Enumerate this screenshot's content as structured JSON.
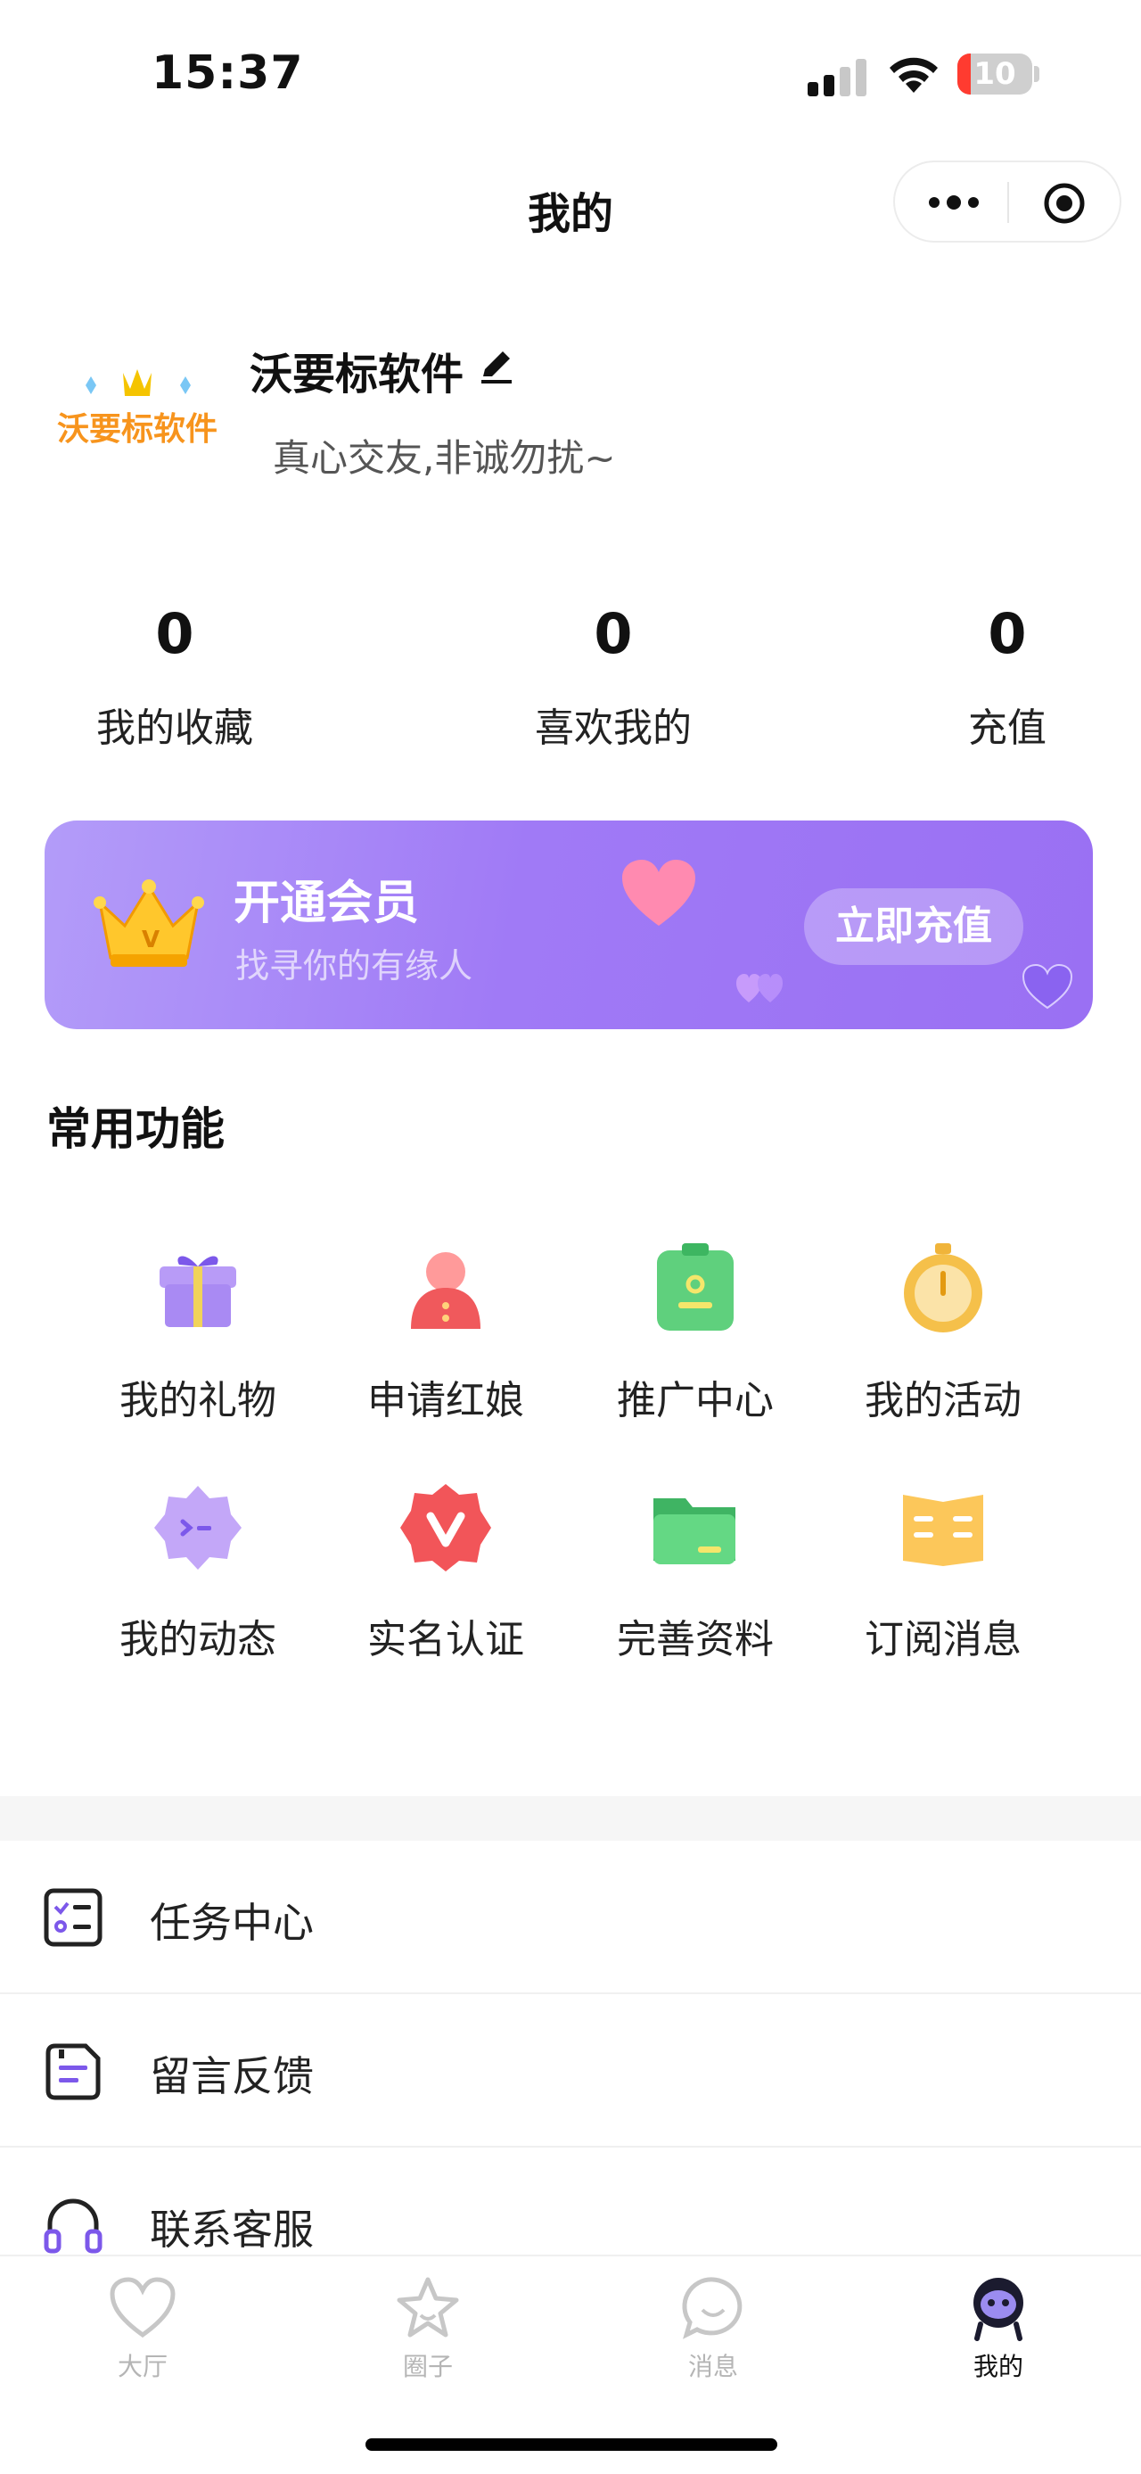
{
  "status_bar": {
    "time": "15:37",
    "battery": "10",
    "battery_level": 0.1
  },
  "nav": {
    "title": "我的"
  },
  "profile": {
    "name": "沃要标软件",
    "logo_text": "沃要标软件",
    "bio": "真心交友,非诚勿扰~"
  },
  "stats": [
    {
      "value": "0",
      "label": "我的收藏"
    },
    {
      "value": "0",
      "label": "喜欢我的"
    },
    {
      "value": "0",
      "label": "充值"
    }
  ],
  "vip": {
    "title": "开通会员",
    "subtitle": "找寻你的有缘人",
    "button": "立即充值"
  },
  "common": {
    "title": "常用功能",
    "items": [
      {
        "label": "我的礼物",
        "icon": "gift-icon"
      },
      {
        "label": "申请红娘",
        "icon": "matchmaker-icon"
      },
      {
        "label": "推广中心",
        "icon": "promotion-icon"
      },
      {
        "label": "我的活动",
        "icon": "activity-icon"
      },
      {
        "label": "我的动态",
        "icon": "moments-icon"
      },
      {
        "label": "实名认证",
        "icon": "verify-icon"
      },
      {
        "label": "完善资料",
        "icon": "folder-icon"
      },
      {
        "label": "订阅消息",
        "icon": "subscribe-icon"
      }
    ]
  },
  "list": [
    {
      "label": "任务中心",
      "icon": "task-list-icon"
    },
    {
      "label": "留言反馈",
      "icon": "feedback-icon"
    },
    {
      "label": "联系客服",
      "icon": "headset-icon"
    }
  ],
  "tabs": [
    {
      "label": "大厅",
      "icon": "heart-icon",
      "active": false
    },
    {
      "label": "圈子",
      "icon": "star-icon",
      "active": false
    },
    {
      "label": "消息",
      "icon": "chat-icon",
      "active": false
    },
    {
      "label": "我的",
      "icon": "profile-icon",
      "active": true
    }
  ],
  "colors": {
    "accent": "#9a70f3",
    "battery_low": "#ff3b30"
  }
}
